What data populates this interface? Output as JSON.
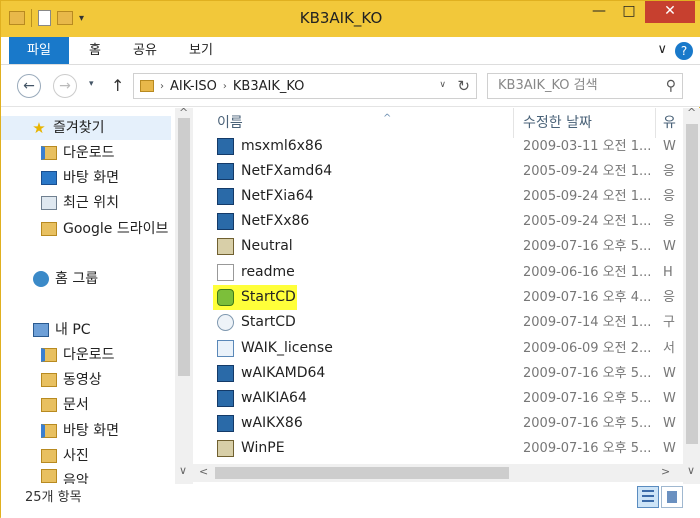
{
  "window": {
    "title": "KB3AIK_KO",
    "minimize": "—",
    "maximize": "□",
    "close": "✕"
  },
  "ribbon": {
    "tabs": [
      "파일",
      "홈",
      "공유",
      "보기"
    ],
    "expand": "∨",
    "help": "?"
  },
  "nav": {
    "back": "←",
    "forward": "→",
    "history": "▾",
    "up": "↑",
    "breadcrumb": [
      "AIK-ISO",
      "KB3AIK_KO"
    ],
    "crumb_sep": "›",
    "address_dropdown": "∨",
    "refresh": "↻",
    "search_placeholder": "KB3AIK_KO 검색",
    "search_icon": "⚲"
  },
  "sidebar": {
    "items": [
      {
        "label": "즐겨찾기",
        "icon": "star-icon"
      },
      {
        "label": "다운로드",
        "icon": "folder-icon"
      },
      {
        "label": "바탕 화면",
        "icon": "desktop-icon"
      },
      {
        "label": "최근 위치",
        "icon": "recent-icon"
      },
      {
        "label": "Google 드라이브",
        "icon": "folder-icon"
      },
      {
        "label": "홈 그룹",
        "icon": "homegroup-icon"
      },
      {
        "label": "내 PC",
        "icon": "pc-icon"
      },
      {
        "label": "다운로드",
        "icon": "folder-icon"
      },
      {
        "label": "동영상",
        "icon": "folder-icon"
      },
      {
        "label": "문서",
        "icon": "folder-icon"
      },
      {
        "label": "바탕 화면",
        "icon": "folder-icon"
      },
      {
        "label": "사진",
        "icon": "folder-icon"
      },
      {
        "label": "음악",
        "icon": "folder-icon"
      }
    ]
  },
  "columns": {
    "name": "이름",
    "date": "수정한 날짜",
    "type": "유",
    "sort": "^"
  },
  "files": [
    {
      "name": "msxml6x86",
      "date": "2009-03-11 오전 1...",
      "type": "W",
      "icon": "setup"
    },
    {
      "name": "NetFXamd64",
      "date": "2005-09-24 오전 1...",
      "type": "응",
      "icon": "setup"
    },
    {
      "name": "NetFXia64",
      "date": "2005-09-24 오전 1...",
      "type": "응",
      "icon": "setup"
    },
    {
      "name": "NetFXx86",
      "date": "2005-09-24 오전 1...",
      "type": "응",
      "icon": "setup"
    },
    {
      "name": "Neutral",
      "date": "2009-07-16 오후 5...",
      "type": "W",
      "icon": "cab"
    },
    {
      "name": "readme",
      "date": "2009-06-16 오전 1...",
      "type": "H",
      "icon": "txt"
    },
    {
      "name": "StartCD",
      "date": "2009-07-16 오후 4...",
      "type": "응",
      "icon": "autorun",
      "highlighted": true
    },
    {
      "name": "StartCD",
      "date": "2009-07-14 오전 1...",
      "type": "구",
      "icon": "inf"
    },
    {
      "name": "WAIK_license",
      "date": "2009-06-09 오전 2...",
      "type": "서",
      "icon": "rtf"
    },
    {
      "name": "wAIKAMD64",
      "date": "2009-07-16 오후 5...",
      "type": "W",
      "icon": "setup"
    },
    {
      "name": "wAIKIA64",
      "date": "2009-07-16 오후 5...",
      "type": "W",
      "icon": "setup"
    },
    {
      "name": "wAIKX86",
      "date": "2009-07-16 오후 5...",
      "type": "W",
      "icon": "setup"
    },
    {
      "name": "WinPE",
      "date": "2009-07-16 오후 5...",
      "type": "W",
      "icon": "cab"
    }
  ],
  "status": {
    "count": "25개 항목"
  },
  "scroll": {
    "up": "^",
    "down": "∨",
    "left": "<",
    "right": ">"
  },
  "colors": {
    "titlebar": "#f2c83a",
    "file_tab": "#1979ca",
    "highlight": "#ffff3a",
    "selection": "#e5f0fb"
  }
}
